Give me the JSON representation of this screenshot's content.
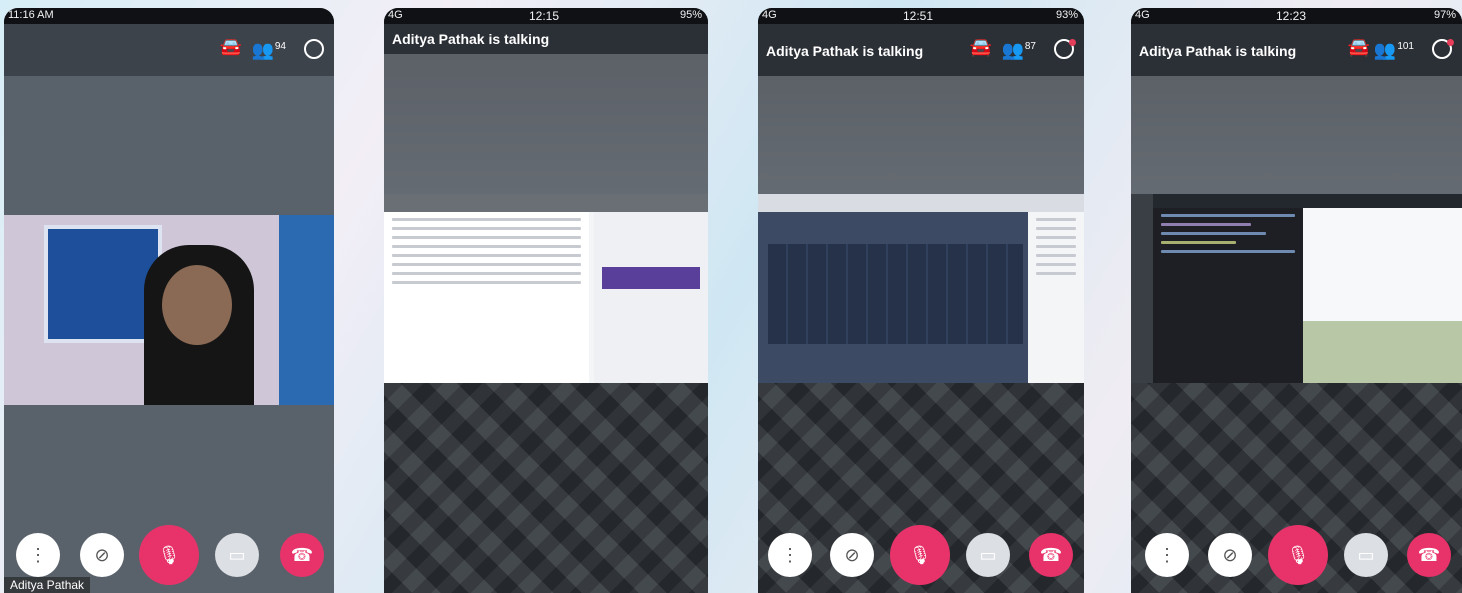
{
  "phones": [
    {
      "status_time": "11:16 AM",
      "participants_count": "94",
      "speaker_name": "Aditya Pathak"
    },
    {
      "status_carrier": "4G",
      "status_time": "12:15",
      "status_battery": "95%",
      "talking_label": "Aditya  Pathak is talking"
    },
    {
      "status_carrier": "4G",
      "status_time": "12:51",
      "status_battery": "93%",
      "talking_label": "Aditya  Pathak is talking",
      "participants_count": "87"
    },
    {
      "status_carrier": "4G",
      "status_time": "12:23",
      "status_battery": "97%",
      "talking_label": "Aditya  Pathak is talking",
      "participants_count": "101"
    }
  ],
  "icons": {
    "car": "car-icon",
    "people": "people-icon",
    "chat": "chat-icon",
    "more": "more-vertical-icon",
    "video_off": "video-off-icon",
    "mic_off": "mic-off-icon",
    "screen_share": "screen-share-icon",
    "hangup": "hangup-icon"
  },
  "colors": {
    "accent": "#e8336a",
    "topbar": "#2b2f36",
    "background": "#59616b"
  }
}
